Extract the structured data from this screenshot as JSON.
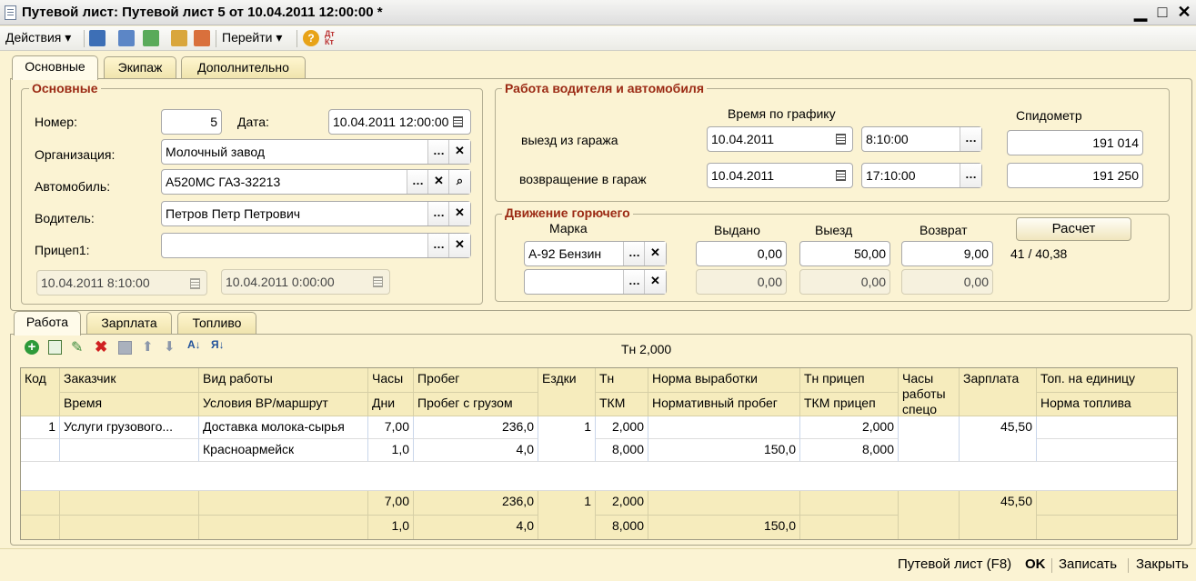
{
  "window": {
    "title": "Путевой лист: Путевой лист 5 от 10.04.2011 12:00:00 *"
  },
  "toolbar": {
    "actions": "Действия",
    "goto": "Перейти"
  },
  "tabs": {
    "main": "Основные",
    "crew": "Экипаж",
    "extra": "Дополнительно"
  },
  "basic": {
    "title": "Основные",
    "number_label": "Номер:",
    "number": "5",
    "date_label": "Дата:",
    "date": "10.04.2011 12:00:00",
    "org_label": "Организация:",
    "org": "Молочный завод",
    "car_label": "Автомобиль:",
    "car": "А520МС ГАЗ-32213",
    "driver_label": "Водитель:",
    "driver": "Петров Петр Петрович",
    "trailer_label": "Прицеп1:",
    "trailer": "",
    "period_from": "10.04.2011  8:10:00",
    "period_to": "10.04.2011  0:00:00"
  },
  "work": {
    "title": "Работа водителя и автомобиля",
    "schedule_header": "Время по графику",
    "speedo_header": "Спидометр",
    "out_label": "выезд из гаража",
    "out_date": "10.04.2011",
    "out_time": "8:10:00",
    "out_speedo": "191 014",
    "back_label": "возвращение в гараж",
    "back_date": "10.04.2011",
    "back_time": "17:10:00",
    "back_speedo": "191 250"
  },
  "fuel": {
    "title": "Движение горючего",
    "brand_header": "Марка",
    "issued_header": "Выдано",
    "out_header": "Выезд",
    "return_header": "Возврат",
    "calc_button": "Расчет",
    "row1": {
      "brand": "А-92 Бензин",
      "issued": "0,00",
      "out": "50,00",
      "ret": "9,00"
    },
    "row2": {
      "brand": "",
      "issued": "0,00",
      "out": "0,00",
      "ret": "0,00"
    },
    "result": "41 / 40,38"
  },
  "subtabs": {
    "work": "Работа",
    "salary": "Зарплата",
    "fuel": "Топливо"
  },
  "gridtb": {
    "tn": "Тн 2,000"
  },
  "grid": {
    "h1": {
      "kod": "Код",
      "customer": "Заказчик",
      "worktype": "Вид работы",
      "hours": "Часы",
      "run": "Пробег",
      "trips": "Ездки",
      "tn": "Тн",
      "norm": "Норма выработки",
      "tn_trailer": "Тн прицеп",
      "hours_special": "Часы работы спецо",
      "salary": "Зарплата",
      "fuel_unit": "Топ. на единицу"
    },
    "h2": {
      "time": "Время",
      "conditions": "Условия ВР/маршрут",
      "days": "Дни",
      "run_cargo": "Пробег с грузом",
      "tkm": "ТКМ",
      "norm_run": "Нормативный пробег",
      "tkm_trailer": "ТКМ прицеп",
      "fuel_norm": "Норма топлива"
    },
    "row1": {
      "kod": "1",
      "customer": "Услуги грузового...",
      "worktype": "Доставка молока-сырья",
      "hours": "7,00",
      "run": "236,0",
      "trips": "1",
      "tn": "2,000",
      "norm": "",
      "tn_trailer": "2,000",
      "salary": "45,50"
    },
    "row2": {
      "conditions": "Красноармейск",
      "days": "1,0",
      "run_cargo": "4,0",
      "tkm": "8,000",
      "norm_run": "150,0",
      "tkm_trailer": "8,000"
    },
    "foot1": {
      "hours": "7,00",
      "run": "236,0",
      "trips": "1",
      "tn": "2,000",
      "salary": "45,50"
    },
    "foot2": {
      "days": "1,0",
      "run_cargo": "4,0",
      "tkm": "8,000",
      "norm_run": "150,0"
    }
  },
  "status": {
    "print": "Путевой лист (F8)",
    "ok": "OK",
    "save": "Записать",
    "close": "Закрыть"
  }
}
